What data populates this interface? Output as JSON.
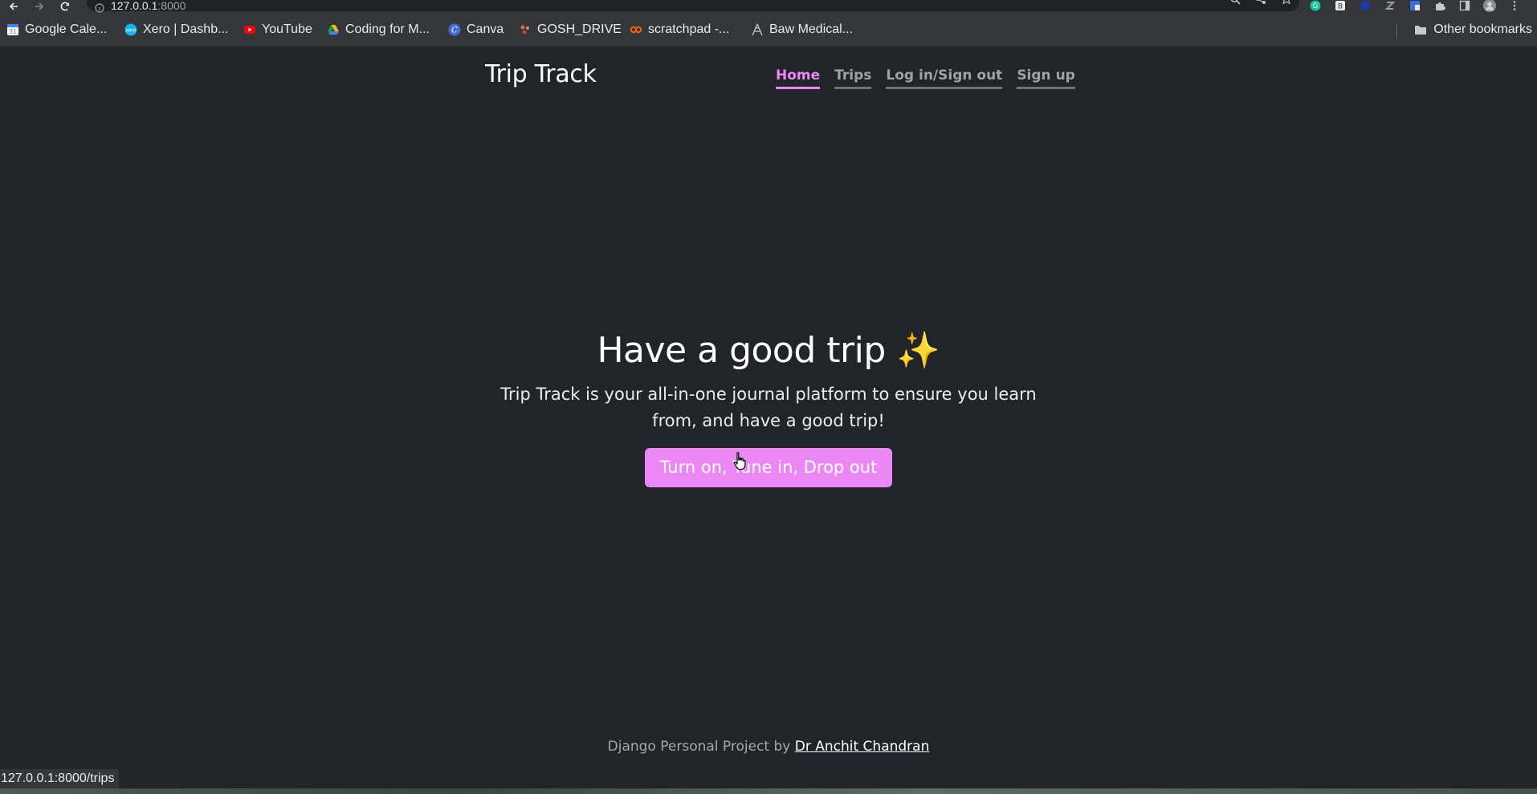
{
  "browser": {
    "url_host": "127.0.0.1",
    "url_port": ":8000",
    "bookmarks": [
      {
        "label": "Google Cale...",
        "icon": "google-calendar-icon"
      },
      {
        "label": "Xero | Dashb...",
        "icon": "xero-icon"
      },
      {
        "label": "YouTube",
        "icon": "youtube-icon"
      },
      {
        "label": "Coding for M...",
        "icon": "google-drive-icon"
      },
      {
        "label": "Canva",
        "icon": "canva-icon"
      },
      {
        "label": "GOSH_DRIVE",
        "icon": "drive-icon"
      },
      {
        "label": "scratchpad -...",
        "icon": "replit-icon"
      },
      {
        "label": "Baw Medical...",
        "icon": "medical-icon"
      }
    ],
    "other_bookmarks": "Other bookmarks",
    "status_url": "127.0.0.1:8000/trips"
  },
  "site": {
    "brand": "Trip Track",
    "nav": [
      {
        "label": "Home",
        "active": true
      },
      {
        "label": "Trips",
        "active": false
      },
      {
        "label": "Log in/Sign out",
        "active": false
      },
      {
        "label": "Sign up",
        "active": false
      }
    ],
    "hero": {
      "title": "Have a good trip ✨",
      "lead": "Trip Track is your all-in-one journal platform to ensure you learn from, and have a good trip!",
      "cta": "Turn on, Tune in, Drop out"
    },
    "footer": {
      "text": "Django Personal Project by ",
      "author_link": "Dr Anchit Chandran"
    }
  },
  "colors": {
    "background": "#212529",
    "accent": "#eb88f5",
    "chrome": "#35363a"
  }
}
